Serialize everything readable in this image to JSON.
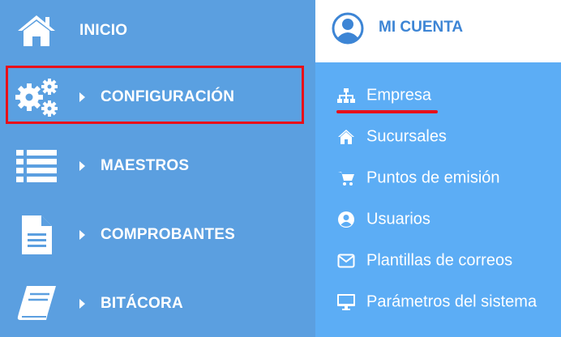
{
  "nav": {
    "items": [
      {
        "label": "INICIO",
        "icon": "home-icon"
      },
      {
        "label": "CONFIGURACIÓN",
        "icon": "gears-icon"
      },
      {
        "label": "MAESTROS",
        "icon": "list-icon"
      },
      {
        "label": "COMPROBANTES",
        "icon": "document-icon"
      },
      {
        "label": "BITÁCORA",
        "icon": "book-icon"
      }
    ]
  },
  "account": {
    "title": "MI CUENTA",
    "icon": "user-circle-icon"
  },
  "submenu": {
    "items": [
      {
        "label": "Empresa",
        "icon": "sitemap-icon"
      },
      {
        "label": "Sucursales",
        "icon": "home-icon"
      },
      {
        "label": "Puntos de emisión",
        "icon": "cart-icon"
      },
      {
        "label": "Usuarios",
        "icon": "user-circle-icon"
      },
      {
        "label": "Plantillas de correos",
        "icon": "envelope-icon"
      },
      {
        "label": "Parámetros del sistema",
        "icon": "monitor-icon"
      }
    ]
  },
  "colors": {
    "nav_bg": "#5b9fe0",
    "submenu_bg": "#5cadf5",
    "accent": "#3d85d5",
    "highlight": "#e8101a"
  }
}
